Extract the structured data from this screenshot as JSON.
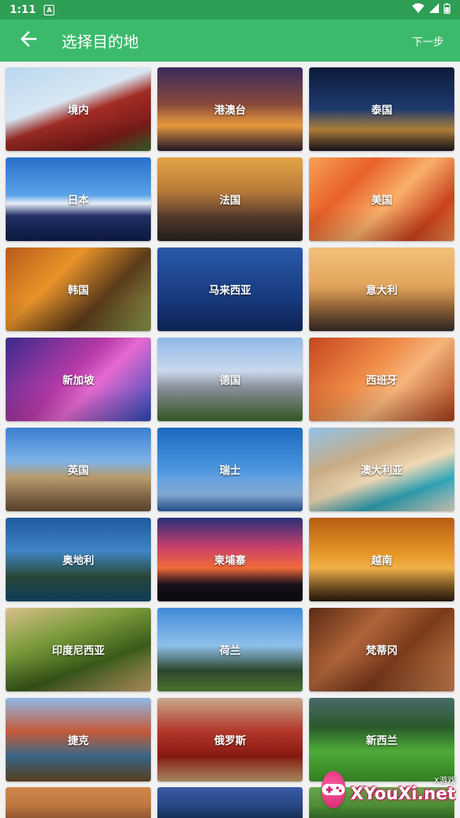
{
  "status": {
    "time": "1:11",
    "notif_glyph": "A"
  },
  "appbar": {
    "title": "选择目的地",
    "next_label": "下一步"
  },
  "destinations": [
    {
      "label": "境内",
      "bg": "linear-gradient(160deg,#b9d7ef 0%,#d8e7f3 40%,#a32c25 55%,#7a1b18 80%,#3a6b2f 100%)"
    },
    {
      "label": "港澳台",
      "bg": "linear-gradient(180deg,#3a2a5c 0%,#8a4a3a 45%,#f0a040 70%,#2a1c30 100%)"
    },
    {
      "label": "泰国",
      "bg": "linear-gradient(180deg,#0e1b3a 0%,#1e3a6e 50%,#b8863a 75%,#1a1420 100%)"
    },
    {
      "label": "日本",
      "bg": "linear-gradient(180deg,#2a6fc9 0%,#5aa2e8 45%,#e8eef8 55%,#23326a 70%,#0f1d4a 100%)"
    },
    {
      "label": "法国",
      "bg": "linear-gradient(180deg,#e6a445 0%,#b87a3a 40%,#5a3e2e 70%,#2a2320 100%)"
    },
    {
      "label": "美国",
      "bg": "linear-gradient(135deg,#f7a156 0%,#e8602a 30%,#f9b06a 55%,#c9411c 80%,#f08a48 100%)"
    },
    {
      "label": "韩国",
      "bg": "linear-gradient(135deg,#b85a1a 0%,#e8932a 35%,#5a3a1a 65%,#8a9a4a 100%)"
    },
    {
      "label": "马来西亚",
      "bg": "linear-gradient(180deg,#2a5aa8 0%,#1a3f86 50%,#0f2a66 100%)"
    },
    {
      "label": "意大利",
      "bg": "linear-gradient(180deg,#f1c07a 0%,#e3a55c 45%,#9a6a3a 70%,#3a2c26 100%)"
    },
    {
      "label": "新加坡",
      "bg": "linear-gradient(135deg,#3a2a8a 0%,#b73aa8 45%,#e56ad0 60%,#2a4ab8 100%)"
    },
    {
      "label": "德国",
      "bg": "linear-gradient(180deg,#8fb8e8 0%,#c9d9ec 40%,#8a8f9a 60%,#3f6a2f 100%)"
    },
    {
      "label": "西班牙",
      "bg": "linear-gradient(135deg,#c5461f 0%,#ef8a46 40%,#f6b47a 60%,#a33a18 100%)"
    },
    {
      "label": "英国",
      "bg": "linear-gradient(180deg,#3a7fd0 0%,#7fb2e6 40%,#b99a6a 60%,#6a5038 100%)"
    },
    {
      "label": "瑞士",
      "bg": "linear-gradient(180deg,#1b6ac0 0%,#4c95de 50%,#8fb8e6 80%,#2a5ea6 100%)"
    },
    {
      "label": "澳大利亚",
      "bg": "linear-gradient(160deg,#8fc2e8 0%,#c9ab84 35%,#f0d9b5 55%,#2fa5b8 75%,#e8e2d0 100%)"
    },
    {
      "label": "奥地利",
      "bg": "linear-gradient(180deg,#1f5a9e 0%,#3f85c5 40%,#2a4a3a 70%,#0f4a6a 100%)"
    },
    {
      "label": "柬埔寨",
      "bg": "linear-gradient(180deg,#2a2e7a 0%,#c8406a 35%,#f06a3a 60%,#1a1220 80%,#0a0a0a 100%)"
    },
    {
      "label": "越南",
      "bg": "linear-gradient(180deg,#b55e10 0%,#e89a2a 45%,#f0b04a 60%,#2a1a0a 100%)"
    },
    {
      "label": "印度尼西亚",
      "bg": "linear-gradient(160deg,#d9c08a 0%,#7a9a3a 35%,#3a5a1a 65%,#c8a46a 100%)"
    },
    {
      "label": "荷兰",
      "bg": "linear-gradient(180deg,#3f8ad8 0%,#8fc0ec 45%,#2f4a2f 75%,#5a8a3a 100%)"
    },
    {
      "label": "梵蒂冈",
      "bg": "linear-gradient(135deg,#5a2a12 0%,#b0643a 35%,#7a3a1a 60%,#c88050 100%)"
    },
    {
      "label": "捷克",
      "bg": "linear-gradient(180deg,#8fb8e6 0%,#c45a3a 40%,#3a6a8a 70%,#6a4a2a 100%)"
    },
    {
      "label": "俄罗斯",
      "bg": "linear-gradient(180deg,#c9a88a 0%,#b2362a 40%,#8a1a12 70%,#c9a070 100%)"
    },
    {
      "label": "新西兰",
      "bg": "linear-gradient(180deg,#4a6a6a 0%,#2a5a2a 35%,#4fae3a 65%,#3f9a2a 100%)"
    }
  ],
  "partial": [
    {
      "bg": "linear-gradient(180deg,#d08a4a 0%,#b06a3a 100%)"
    },
    {
      "bg": "linear-gradient(180deg,#3a5aa8 0%,#1a3a6a 100%)"
    },
    {
      "bg": "linear-gradient(180deg,#6aa84a 0%,#3a7a2a 100%)"
    }
  ],
  "watermark": {
    "small": "X游戏",
    "main": "XYouXi.net"
  },
  "colors": {
    "appbar": "#3cba6b",
    "statusbar": "#2e9e55",
    "background": "#f2f2f2"
  }
}
